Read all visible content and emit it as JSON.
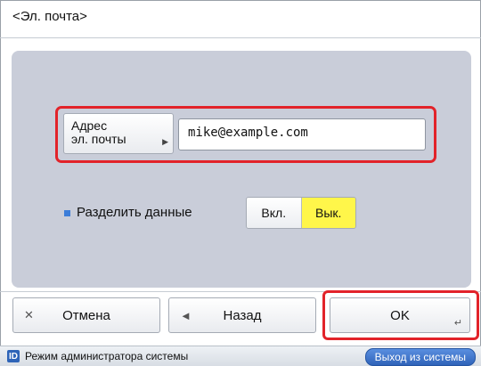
{
  "header": {
    "title": "<Эл. почта>"
  },
  "address": {
    "label_line1": "Адрес",
    "label_line2": "эл. почты",
    "value": "mike@example.com"
  },
  "split": {
    "label": "Разделить данные",
    "on_label": "Вкл.",
    "off_label": "Вык.",
    "selected": "Вык."
  },
  "buttons": {
    "cancel_icon": "✕",
    "cancel_label": "Отмена",
    "back_icon": "◄",
    "back_label": "Назад",
    "ok_label": "OK",
    "ok_corner": "↵"
  },
  "status": {
    "badge": "ID",
    "mode_text": "Режим администратора системы",
    "logout_label": "Выход из системы"
  },
  "colors": {
    "highlight": "#e2232a",
    "selected_toggle": "#fff64a",
    "panel": "#c9cdd9",
    "logout_button": "#2f63b9"
  }
}
